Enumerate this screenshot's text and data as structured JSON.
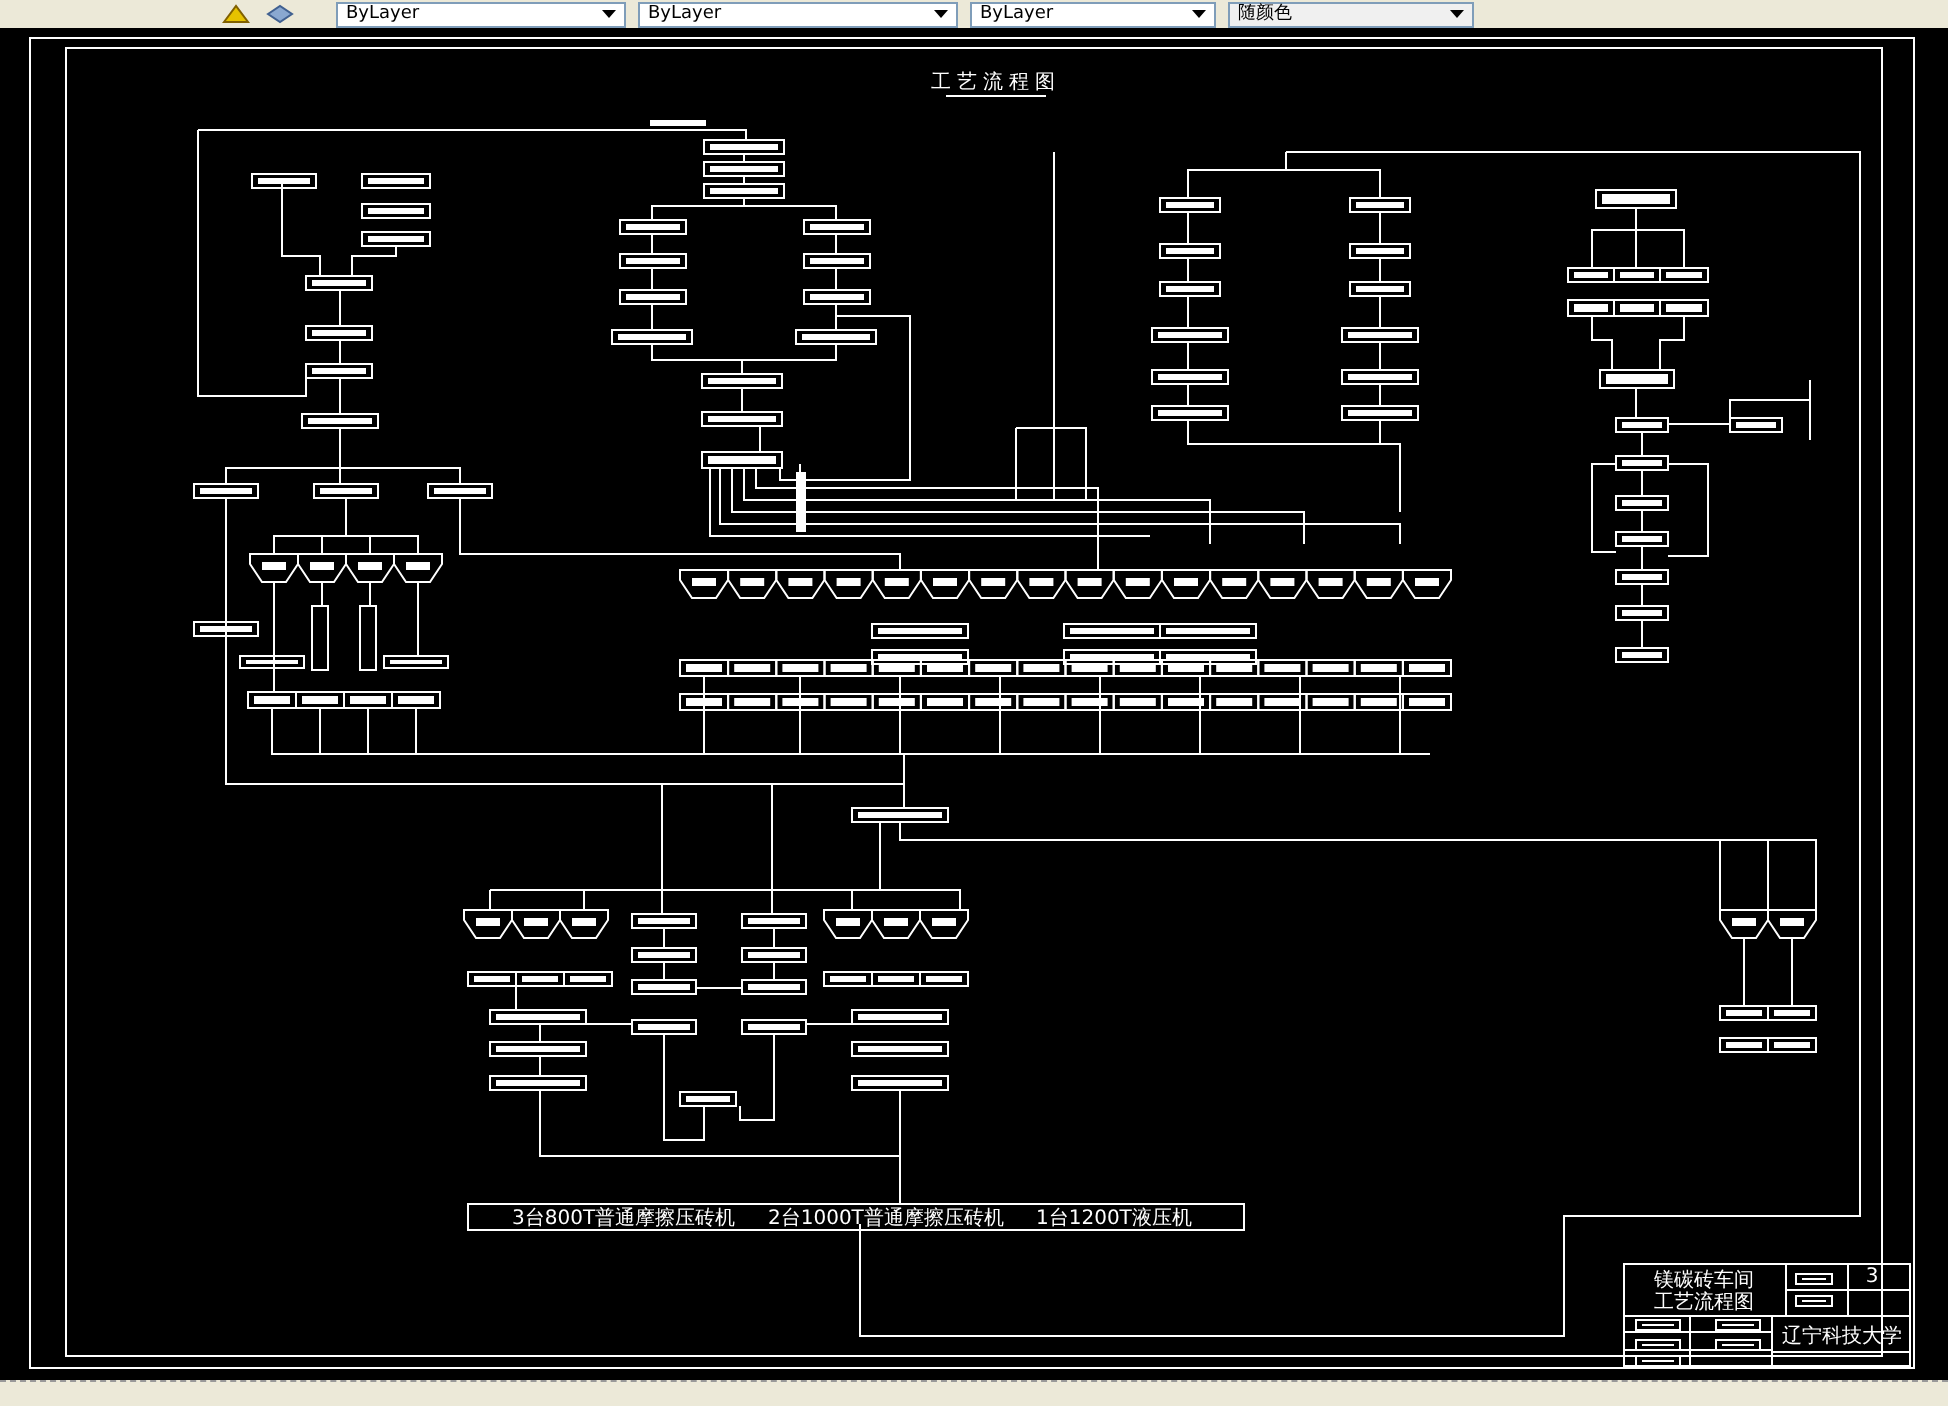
{
  "toolbar": {
    "dropdowns": [
      {
        "value": "ByLayer"
      },
      {
        "value": "ByLayer"
      },
      {
        "value": "ByLayer"
      },
      {
        "value": "随颜色"
      }
    ]
  },
  "drawing": {
    "title": "工艺流程图",
    "caption": [
      "3台800T普通摩擦压砖机",
      "2台1000T普通摩擦压砖机",
      "1台1200T液压机"
    ],
    "title_block": {
      "drawing_name": [
        "镁碳砖车间",
        "工艺流程图"
      ],
      "sheet_number": "3",
      "institution": "辽宁科技大学"
    }
  }
}
